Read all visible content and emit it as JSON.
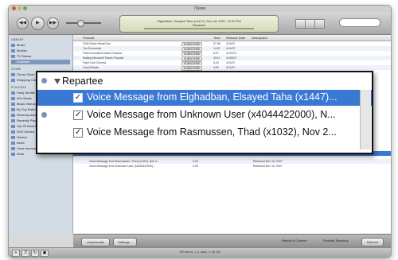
{
  "window": {
    "title": "iTunes"
  },
  "toolbar": {
    "prev_icon": "rewind-icon",
    "play_icon": "play-icon",
    "next_icon": "fastforward-icon",
    "lcd_line1": "Elghadban, Elsayed Taha (x1447), Nov 18, 2007, 12:00 PM",
    "lcd_line2": "Repartee"
  },
  "sidebar": {
    "sections": [
      {
        "header": "LIBRARY",
        "items": [
          "Music",
          "Movies",
          "TV Shows",
          "Podcasts"
        ]
      },
      {
        "header": "STORE",
        "items": [
          "iTunes Store",
          "Shopping Cart"
        ]
      },
      {
        "header": "PLAYLISTS",
        "items": [
          "Party Shuffle",
          "90's Music",
          "Music Videos",
          "My Top Rated",
          "Recently Added",
          "Recently Played",
          "Top 25 Most Played",
          "DVD Movies",
          "Genius",
          "Inbox",
          "Voice memos pending",
          "Work"
        ]
      }
    ]
  },
  "table": {
    "columns": [
      "Podcast",
      "Time",
      "Release Date",
      "Description"
    ],
    "rows": [
      {
        "name": "CNN Radio NewsCast",
        "button": "SUBSCRIBE",
        "time": "57:46",
        "date": "11/4/07",
        "desc": ""
      },
      {
        "name": "The Economist",
        "button": "SUBSCRIBE",
        "time": "14:37",
        "date": "11/1/07",
        "desc": ""
      },
      {
        "name": "Field Innovation Media Podcast",
        "button": "SUBSCRIBE",
        "time": "6:07",
        "date": "11/21/07",
        "desc": ""
      },
      {
        "name": "Making Microsoft Teams Podcast",
        "button": "SUBSCRIBE",
        "time": "43:11",
        "date": "11/28/07",
        "desc": ""
      },
      {
        "name": "Fight Club Cinema",
        "button": "SUBSCRIBE",
        "time": "5:20",
        "date": "11/1/07",
        "desc": ""
      },
      {
        "name": "Good Reads",
        "button": "SUBSCRIBE",
        "time": "4:02",
        "date": "11/1/07",
        "desc": ""
      },
      {
        "name": "HeadBoB TV - Video Podcast (HD)",
        "button": "SUBSCRIBE",
        "time": "3:58",
        "date": "11/1/07",
        "desc": ""
      }
    ],
    "lower_rows": [
      {
        "name": "Voice Message from Rasmussen, Thad (x1032), Nov 2...",
        "time": "0:32",
        "date": "Released Nov 16, 2007"
      },
      {
        "name": "Voice Message from Unknown User (x4044422000)...",
        "time": "0:25",
        "date": "Released Nov 16, 2007"
      }
    ]
  },
  "bottombar": {
    "unsubscribe_label": "Unsubscribe",
    "settings_label": "Settings...",
    "report_label": "Report a Concern",
    "directory_label": "Podcast Directory",
    "refresh_label": "Refresh"
  },
  "statusbar": {
    "text": "393 items, 1.1 days, 2.36 GB"
  },
  "callout": {
    "header": "Repartee",
    "messages": [
      {
        "text": "Voice Message from Elghadban, Elsayed Taha (x1447)...",
        "selected": true,
        "checked": true,
        "unplayed": false
      },
      {
        "text": "Voice Message from Unknown User (x4044422000), N...",
        "selected": false,
        "checked": true,
        "unplayed": true
      },
      {
        "text": "Voice Message from Rasmussen, Thad (x1032), Nov 2...",
        "selected": false,
        "checked": true,
        "unplayed": false
      }
    ]
  },
  "colors": {
    "selection": "#3a78d4",
    "sidebar_bg": "#d3dbe5",
    "lcd_bg": "#e4e9cc"
  }
}
